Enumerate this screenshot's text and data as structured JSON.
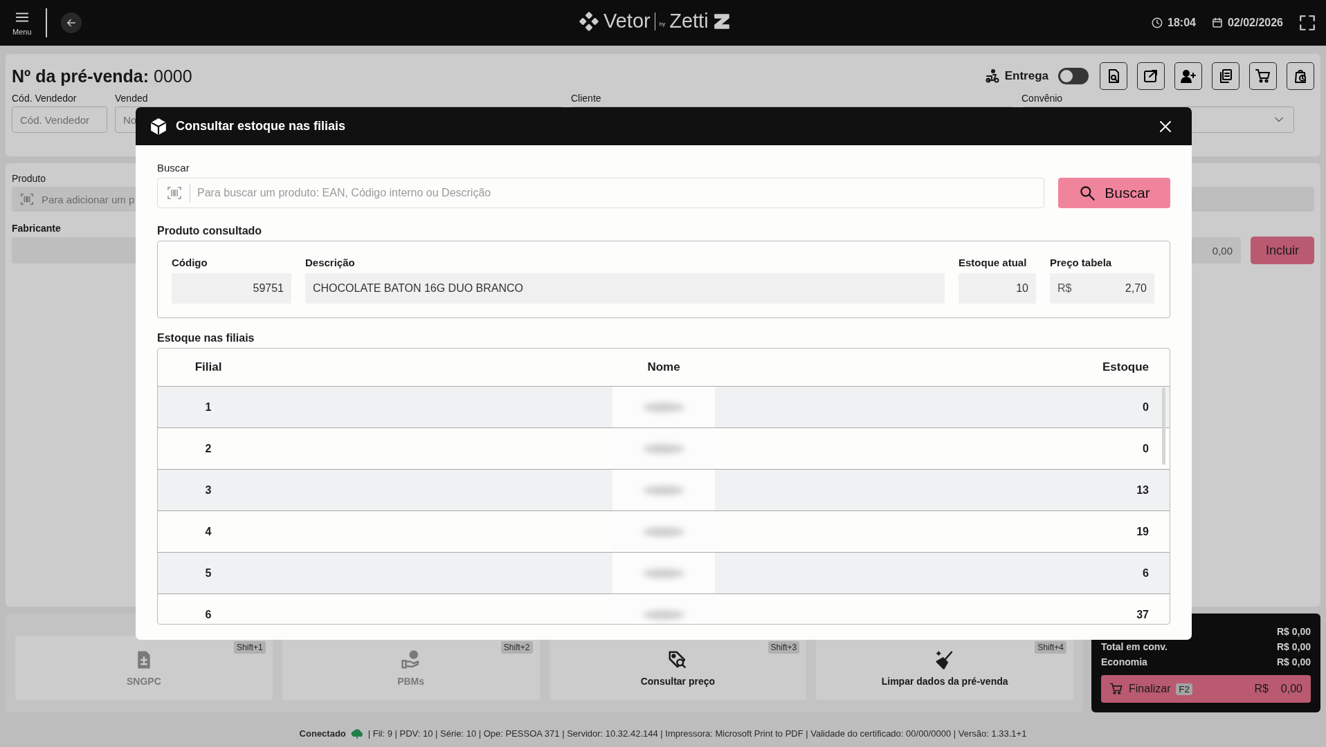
{
  "topbar": {
    "menu_label": "Menu",
    "logo": {
      "left": "Vetor",
      "by": "by",
      "right": "Zetti"
    },
    "time": "18:04",
    "date": "02/02/2026"
  },
  "sale": {
    "title": "Nº da pré-venda:",
    "number": "0000",
    "delivery": {
      "label": "Entrega",
      "on": false
    }
  },
  "seller_code": {
    "label": "Cód. Vendedor",
    "placeholder": "Cód. Vendedor"
  },
  "seller": {
    "label": "Vended",
    "placeholder": "No"
  },
  "client": {
    "label": "Cliente"
  },
  "agreement": {
    "label": "Convênio"
  },
  "product": {
    "label": "Produto",
    "placeholder": "Para adicionar um p"
  },
  "manufacturer": {
    "label": "Fabricante"
  },
  "amount": "0,00",
  "include_button": "Incluir",
  "actions": [
    {
      "label": "SNGPC",
      "shortcut": "Shift+1",
      "disabled": true,
      "kind": "document"
    },
    {
      "label": "PBMs",
      "shortcut": "Shift+2",
      "disabled": true,
      "kind": "hand"
    },
    {
      "label": "Consultar preço",
      "shortcut": "Shift+3",
      "disabled": false,
      "kind": "tag"
    },
    {
      "label": "Limpar dados da pré-venda",
      "shortcut": "Shift+4",
      "disabled": false,
      "kind": "broom"
    }
  ],
  "totals": {
    "rows": [
      {
        "value": "R$ 0,00"
      },
      {
        "label": "Total em conv.",
        "value": "R$ 0,00"
      },
      {
        "label": "Economia",
        "value": "R$ 0,00"
      }
    ],
    "finalize": {
      "label": "Finalizar",
      "key": "F2",
      "currency": "R$",
      "value": "0,00"
    }
  },
  "status_bar": {
    "connection": "Conectado",
    "info": "| Fil: 9 | PDV: 10 | Série: 10 | Ope: PESSOA 371 | Servidor: 10.32.42.144 | Impressora: Microsoft Print to PDF | Validade do certificado: 00/00/0000 | Versão: 1.33.1+1"
  },
  "modal": {
    "title": "Consultar estoque nas filiais",
    "search": {
      "label": "Buscar",
      "placeholder": "Para buscar um produto: EAN, Código interno ou Descrição",
      "button": "Buscar"
    },
    "product_title": "Produto consultado",
    "fields": [
      {
        "label": "Código",
        "value": "59751",
        "kind": "number"
      },
      {
        "label": "Descrição",
        "value": "CHOCOLATE BATON 16G DUO BRANCO",
        "kind": "text"
      },
      {
        "label": "Estoque atual",
        "value": "10",
        "kind": "number"
      },
      {
        "label": "Preço tabela",
        "prefix": "R$",
        "value": "2,70",
        "kind": "number"
      }
    ],
    "branches": {
      "title": "Estoque nas filiais",
      "columns": [
        "Filial",
        "Nome",
        "Estoque"
      ],
      "rows": [
        {
          "branch": "1",
          "stock": "0"
        },
        {
          "branch": "2",
          "stock": "0"
        },
        {
          "branch": "3",
          "stock": "13"
        },
        {
          "branch": "4",
          "stock": "19"
        },
        {
          "branch": "5",
          "stock": "6"
        },
        {
          "branch": "6",
          "stock": "37"
        }
      ]
    }
  }
}
